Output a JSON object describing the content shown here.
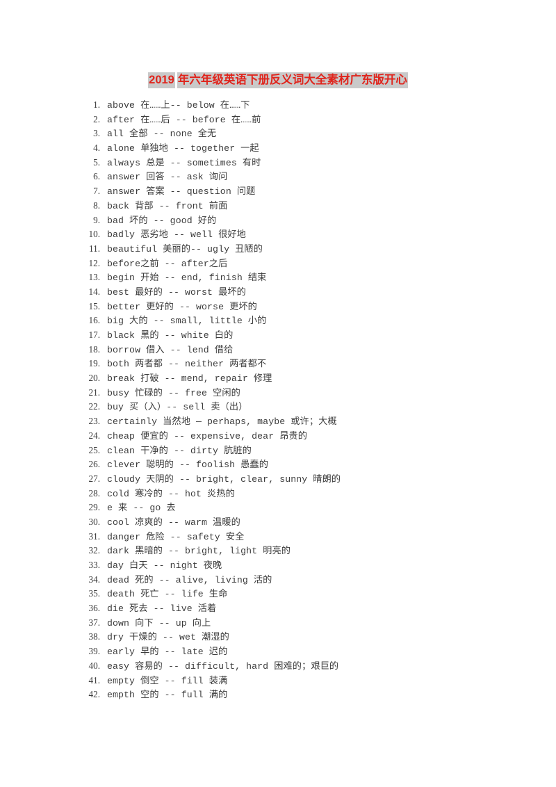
{
  "document": {
    "title_parts": [
      "2019",
      "年六年级英语下册反义词大全素材广东版开心"
    ],
    "title_color": "#e0241c",
    "title_highlight_color": "#c9c9c9",
    "page_background": "#ffffff",
    "body_text_color": "#3b3b3b"
  },
  "list": {
    "items": [
      {
        "number": "1.",
        "text": "above 在……上-- below 在……下"
      },
      {
        "number": "2.",
        "text": "after 在……后 -- before 在……前"
      },
      {
        "number": "3.",
        "text": "all 全部 -- none 全无"
      },
      {
        "number": "4.",
        "text": "alone 单独地 -- together 一起"
      },
      {
        "number": "5.",
        "text": "always 总是 -- sometimes 有时"
      },
      {
        "number": "6.",
        "text": "answer 回答 -- ask 询问"
      },
      {
        "number": "7.",
        "text": "answer 答案 -- question 问题"
      },
      {
        "number": "8.",
        "text": "back 背部 -- front 前面"
      },
      {
        "number": "9.",
        "text": "bad 坏的 -- good 好的"
      },
      {
        "number": "10.",
        "text": "badly 恶劣地 -- well 很好地"
      },
      {
        "number": "11.",
        "text": "beautiful 美丽的-- ugly 丑陋的"
      },
      {
        "number": "12.",
        "text": "before之前 -- after之后"
      },
      {
        "number": "13.",
        "text": "begin 开始 -- end, finish 结束"
      },
      {
        "number": "14.",
        "text": "best 最好的 -- worst 最坏的"
      },
      {
        "number": "15.",
        "text": "better 更好的 -- worse 更坏的"
      },
      {
        "number": "16.",
        "text": "big 大的 -- small, little 小的"
      },
      {
        "number": "17.",
        "text": "black 黑的 -- white 白的"
      },
      {
        "number": "18.",
        "text": "borrow 借入 -- lend 借给"
      },
      {
        "number": "19.",
        "text": "both 两者都 -- neither 两者都不"
      },
      {
        "number": "20.",
        "text": "break 打破 -- mend, repair 修理"
      },
      {
        "number": "21.",
        "text": "busy 忙碌的 -- free 空闲的"
      },
      {
        "number": "22.",
        "text": "buy 买（入）-- sell 卖（出）"
      },
      {
        "number": "23.",
        "text": "certainly 当然地 — perhaps, maybe 或许；大概"
      },
      {
        "number": "24.",
        "text": "cheap 便宜的 -- expensive, dear 昂贵的"
      },
      {
        "number": "25.",
        "text": "clean 干净的 -- dirty 肮脏的"
      },
      {
        "number": "26.",
        "text": "clever 聪明的 -- foolish 愚蠢的"
      },
      {
        "number": "27.",
        "text": "cloudy 天阴的 -- bright, clear, sunny 晴朗的"
      },
      {
        "number": "28.",
        "text": "cold 寒冷的 -- hot 炎热的"
      },
      {
        "number": "29.",
        "text": "e 来 -- go 去"
      },
      {
        "number": "30.",
        "text": "cool 凉爽的 -- warm 温暖的"
      },
      {
        "number": "31.",
        "text": "danger 危险 -- safety 安全"
      },
      {
        "number": "32.",
        "text": "dark 黑暗的 -- bright, light 明亮的"
      },
      {
        "number": "33.",
        "text": "day 白天 -- night 夜晚"
      },
      {
        "number": "34.",
        "text": "dead 死的 -- alive, living 活的"
      },
      {
        "number": "35.",
        "text": "death 死亡 -- life 生命"
      },
      {
        "number": "36.",
        "text": "die 死去 -- live 活着"
      },
      {
        "number": "37.",
        "text": "down 向下 -- up 向上"
      },
      {
        "number": "38.",
        "text": "dry 干燥的 -- wet 潮湿的"
      },
      {
        "number": "39.",
        "text": "early 早的 -- late 迟的"
      },
      {
        "number": "40.",
        "text": "easy 容易的 -- difficult, hard 困难的；艰巨的"
      },
      {
        "number": "41.",
        "text": "empty 倒空 -- fill 装满"
      },
      {
        "number": "42.",
        "text": "empth 空的 -- full 满的"
      }
    ]
  }
}
